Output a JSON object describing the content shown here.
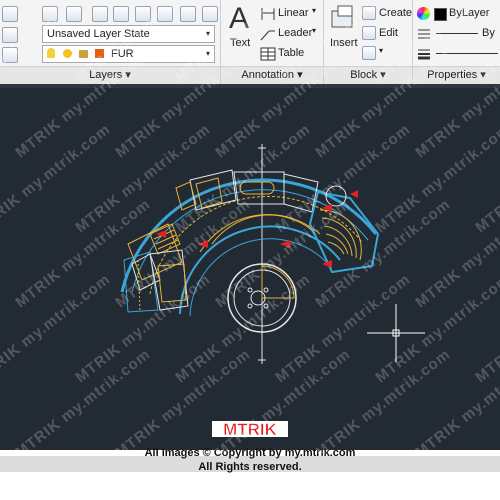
{
  "ribbon": {
    "layers": {
      "layer_state": "Unsaved Layer State",
      "current_layer": "FUR",
      "panel_label": "Layers"
    },
    "annotation": {
      "text_label": "Text",
      "linear_label": "Linear",
      "leader_label": "Leader",
      "table_label": "Table",
      "panel_label": "Annotation"
    },
    "block": {
      "insert_label": "Insert",
      "create_label": "Create",
      "edit_label": "Edit",
      "panel_label": "Block"
    },
    "properties": {
      "color_label": "ByLayer",
      "linetype_label": "By",
      "lineweight_label": "",
      "panel_label": "Properties"
    },
    "dropdown_arrow": "▾"
  },
  "footer": {
    "brand": "MTRIK",
    "copyright_line1": "All images © Copyright by my.mtrik.com",
    "copyright_line2": "All Rights reserved."
  },
  "watermark": {
    "text": "MTRIK",
    "url_text": "my.mtrik.com"
  },
  "colors": {
    "canvas": "#222a33",
    "cad_yellow": "#e8b338",
    "cad_blue": "#3aa6d8",
    "cad_white": "#e6e6e6",
    "cad_red": "#e02222",
    "brand_red": "#e51b1b"
  },
  "icons": [
    "match-layer-icon",
    "layer-isolate-icon",
    "layer-freeze-icon",
    "lightbulb-icon",
    "sun-icon",
    "lock-icon",
    "text-icon",
    "linear-dimension-icon",
    "leader-icon",
    "table-icon",
    "insert-block-icon",
    "create-block-icon",
    "edit-block-icon",
    "color-wheel-icon",
    "crosshair-cursor-icon"
  ]
}
